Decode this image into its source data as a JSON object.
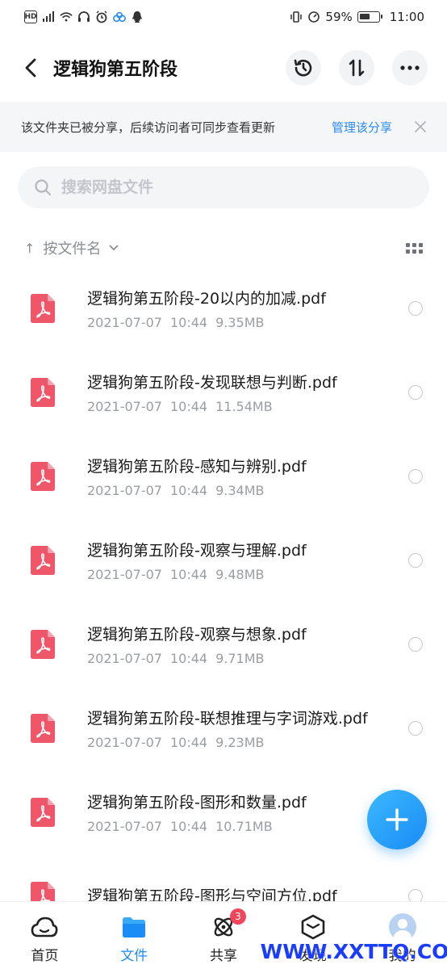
{
  "status_bar": {
    "left_badges": [
      "HD",
      "5G"
    ],
    "battery_text": "59%",
    "battery_level": 0.59,
    "time": "11:00"
  },
  "header": {
    "title": "逻辑狗第五阶段",
    "icons": [
      "back-arrow-icon",
      "history-icon",
      "sort-swap-icon",
      "more-icon"
    ]
  },
  "share_notice": {
    "text": "该文件夹已被分享，后续访问者可同步查看更新",
    "manage_label": "管理该分享"
  },
  "search": {
    "placeholder": "搜索网盘文件"
  },
  "sort": {
    "label": "按文件名"
  },
  "files": [
    {
      "name": "逻辑狗第五阶段-20以内的加减.pdf",
      "date": "2021-07-07",
      "time": "10:44",
      "size": "9.35MB"
    },
    {
      "name": "逻辑狗第五阶段-发现联想与判断.pdf",
      "date": "2021-07-07",
      "time": "10:44",
      "size": "11.54MB"
    },
    {
      "name": "逻辑狗第五阶段-感知与辨别.pdf",
      "date": "2021-07-07",
      "time": "10:44",
      "size": "9.34MB"
    },
    {
      "name": "逻辑狗第五阶段-观察与理解.pdf",
      "date": "2021-07-07",
      "time": "10:44",
      "size": "9.48MB"
    },
    {
      "name": "逻辑狗第五阶段-观察与想象.pdf",
      "date": "2021-07-07",
      "time": "10:44",
      "size": "9.71MB"
    },
    {
      "name": "逻辑狗第五阶段-联想推理与字词游戏.pdf",
      "date": "2021-07-07",
      "time": "10:44",
      "size": "9.23MB"
    },
    {
      "name": "逻辑狗第五阶段-图形和数量.pdf",
      "date": "2021-07-07",
      "time": "10:44",
      "size": "10.71MB"
    },
    {
      "name": "逻辑狗第五阶段-图形与空间方位.pdf",
      "date": "",
      "time": "",
      "size": ""
    }
  ],
  "bottom_nav": {
    "items": [
      {
        "label": "首页",
        "icon": "cloud-home-icon"
      },
      {
        "label": "文件",
        "icon": "folder-icon"
      },
      {
        "label": "共享",
        "icon": "atom-share-icon",
        "badge": "3"
      },
      {
        "label": "发现",
        "icon": "cube-discover-icon"
      },
      {
        "label": "我的",
        "icon": "avatar-icon"
      }
    ]
  },
  "watermark": "WWW.XXTTQ.COM",
  "colors": {
    "accent": "#1a8cf5",
    "pdf_red": "#f0566a",
    "badge_red": "#f0455a"
  }
}
